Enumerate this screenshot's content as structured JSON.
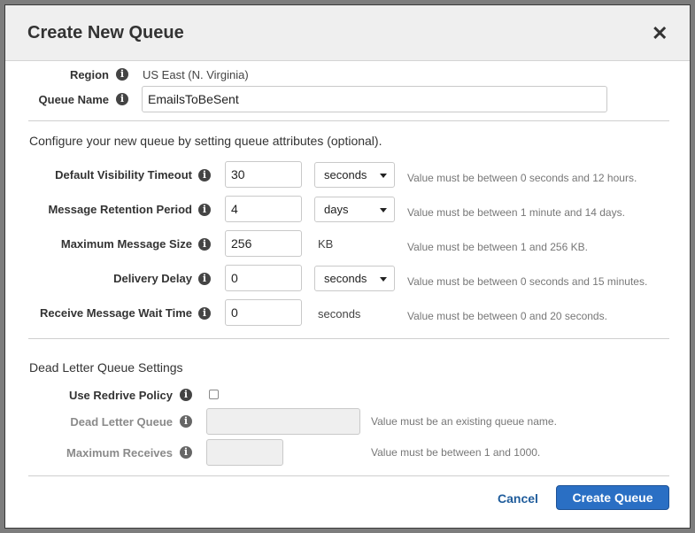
{
  "dialog": {
    "title": "Create New Queue",
    "close_icon": "close-icon"
  },
  "region": {
    "label": "Region",
    "value": "US East (N. Virginia)"
  },
  "queue_name": {
    "label": "Queue Name",
    "value": "EmailsToBeSent"
  },
  "attributes_intro": "Configure your new queue by setting queue attributes (optional).",
  "attributes": {
    "visibility_timeout": {
      "label": "Default Visibility Timeout",
      "value": "30",
      "unit": "seconds",
      "hint": "Value must be between 0 seconds and 12 hours."
    },
    "retention_period": {
      "label": "Message Retention Period",
      "value": "4",
      "unit": "days",
      "hint": "Value must be between 1 minute and 14 days."
    },
    "max_message_size": {
      "label": "Maximum Message Size",
      "value": "256",
      "unit": "KB",
      "hint": "Value must be between 1 and 256 KB."
    },
    "delivery_delay": {
      "label": "Delivery Delay",
      "value": "0",
      "unit": "seconds",
      "hint": "Value must be between 0 seconds and 15 minutes."
    },
    "receive_wait_time": {
      "label": "Receive Message Wait Time",
      "value": "0",
      "unit": "seconds",
      "hint": "Value must be between 0 and 20 seconds."
    }
  },
  "dead_letter": {
    "section_title": "Dead Letter Queue Settings",
    "redrive": {
      "label": "Use Redrive Policy",
      "checked": false
    },
    "queue": {
      "label": "Dead Letter Queue",
      "value": "",
      "hint": "Value must be an existing queue name."
    },
    "max_receives": {
      "label": "Maximum Receives",
      "value": "",
      "hint": "Value must be between 1 and 1000."
    }
  },
  "footer": {
    "cancel_label": "Cancel",
    "create_label": "Create Queue"
  },
  "colors": {
    "primary_button": "#2a6fc4",
    "link": "#1f5c9b",
    "header_bg": "#efefef"
  }
}
